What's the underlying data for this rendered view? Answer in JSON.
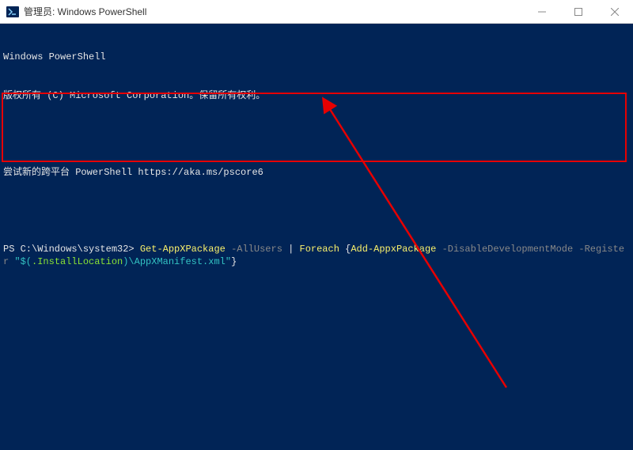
{
  "titlebar": {
    "title": "管理员: Windows PowerShell"
  },
  "terminal": {
    "header1": "Windows PowerShell",
    "header2": "版权所有 (C) Microsoft Corporation。保留所有权利。",
    "tryNew": "尝试新的跨平台 PowerShell https://aka.ms/pscore6",
    "prompt": "PS C:\\Windows\\system32>",
    "cmd": {
      "p1": "Get-AppXPackage",
      "p2": "-AllUsers",
      "p3": "|",
      "p4": "Foreach",
      "p5": "{",
      "p6": "Add-AppxPackage",
      "p7": "-DisableDevelopmentMode",
      "p8": "-Register",
      "p9": "\"$(",
      "p10": ".InstallLocation",
      "p11": ")\\AppXManifest.xml\"",
      "p12": "}"
    }
  }
}
